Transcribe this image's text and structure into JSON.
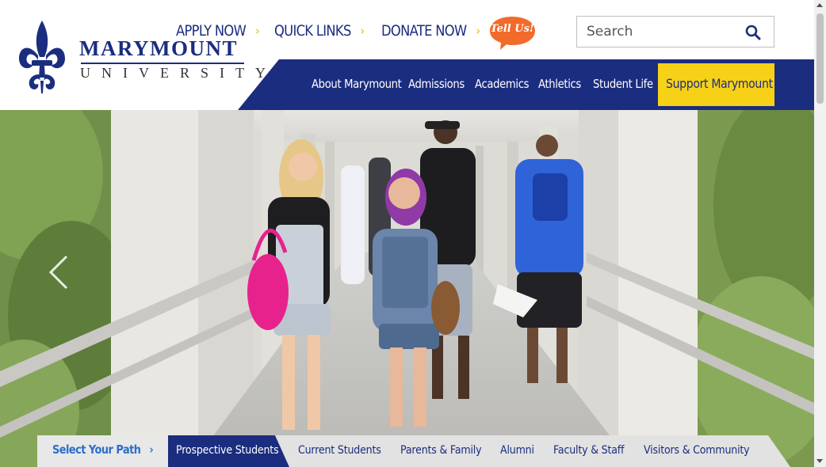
{
  "brand": {
    "name": "MARYMOUNT",
    "sub": "UNIVERSITY",
    "colors": {
      "navy": "#1b2d7f",
      "gold": "#f7d117",
      "link_blue": "#2d6ec9",
      "tell_us": "#f26b2a"
    }
  },
  "top_links": [
    {
      "label": "APPLY NOW",
      "icon": "chevron-right-icon"
    },
    {
      "label": "QUICK LINKS",
      "icon": "chevron-right-icon"
    },
    {
      "label": "DONATE NOW",
      "icon": "chevron-right-icon"
    }
  ],
  "tell_us": {
    "label": "Tell Us!",
    "icon": "speech-bubble-icon"
  },
  "search": {
    "placeholder": "Search",
    "value": "",
    "icon": "search-icon"
  },
  "main_nav": {
    "items": [
      "About Marymount",
      "Admissions",
      "Academics",
      "Athletics",
      "Student Life"
    ],
    "cta": "Support Marymount"
  },
  "hero": {
    "description_icon": "chevron-left-icon"
  },
  "path_bar": {
    "label": "Select Your Path",
    "label_icon": "chevron-right-icon",
    "tabs": [
      "Prospective Students",
      "Current Students",
      "Parents & Family",
      "Alumni",
      "Faculty & Staff",
      "Visitors & Community"
    ],
    "active_tab": "Prospective Students"
  }
}
